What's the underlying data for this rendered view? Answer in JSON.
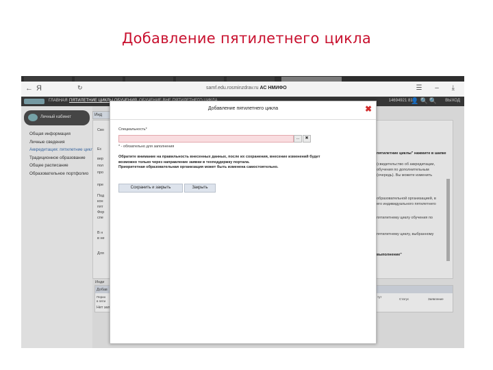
{
  "slide_title": "Добавление пятилетнего цикла",
  "browser": {
    "back_glyph": "←",
    "yandex_glyph": "Я",
    "reload_glyph": "↻",
    "url_host": "samf.edu.rosminzdrav.ru",
    "url_site": "АС НМИФО",
    "toolbar_glyphs": "☰ – ⤓"
  },
  "header": {
    "nav": [
      "ГЛАВНАЯ",
      "ПЯТИЛЕТНИЕ ЦИКЛЫ ОБУЧЕНИЯ",
      "ОБУЧЕНИЕ ВНЕ ПЯТИЛЕТНЕГО ЦИКЛА"
    ],
    "user_id": "14694921 815",
    "icons": "👤🔍🔍",
    "logout_label": "ВЫХОД"
  },
  "sidebar": {
    "cabinet_label": "Личный кабинет",
    "items": [
      {
        "label": "Общая информация",
        "active": false
      },
      {
        "label": "Личные сведения",
        "active": false
      },
      {
        "label": "Аккредитация: пятилетние циклы",
        "active": true
      },
      {
        "label": "Традиционное образование",
        "active": false
      },
      {
        "label": "Общее расписание",
        "active": false
      },
      {
        "label": "Образовательное портфолио",
        "active": false
      }
    ]
  },
  "background_page": {
    "tab_label": "Инд",
    "tab2_label": "Сво",
    "right_col": [
      "пятилетние циклы\" нажмите в шапке",
      "(свидетельство об аккредитации,",
      "обучения по дополнительным",
      "(очередь). Вы можете изменить",
      "образовательной организацией, в",
      "его индивидуального пятилетнего",
      "пятилетнему циклу обучения по",
      "пятилетнему циклу, выбранному",
      "выполнение\""
    ],
    "left_col": [
      "Ес",
      "вер",
      "пол",
      "про",
      "пре",
      "Под",
      "кон",
      "пят",
      "Фор",
      "спе",
      "В н",
      "в не",
      "Для"
    ],
    "table_caption": "Инди",
    "table_col1": "Добав",
    "table_cells": [
      "Перио",
      "в пяти",
      "Нет зап"
    ],
    "table_headers_right": [
      "тут",
      "Статус",
      "Заявление"
    ]
  },
  "modal": {
    "title": "Добавление пятилетнего цикла",
    "close_glyph": "✖",
    "field_label": "Специальность*",
    "field_value": "",
    "browse_label": "...",
    "clear_label": "✖",
    "required_note": "* - обязательно для заполнения",
    "warning_lines": [
      "Обратите внимание на правильность внесенных данных, после их сохранения, внесение изменений будет",
      "возможно только через направление заявки в техподдержку портала.",
      "Приоритетная образовательная организация может быть изменена самостоятельно."
    ],
    "save_close_label": "Сохранить и закрыть",
    "close_label": "Закрыть"
  }
}
